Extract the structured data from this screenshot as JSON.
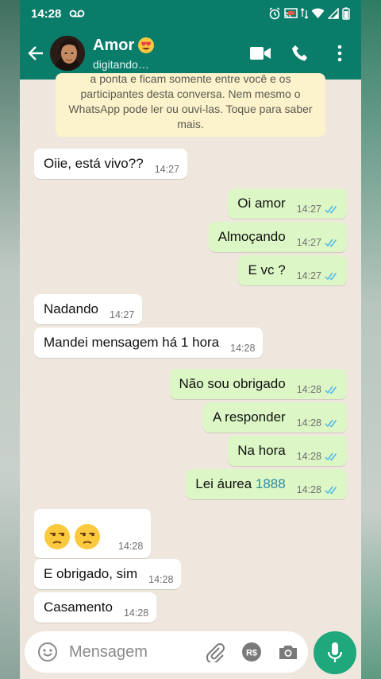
{
  "status": {
    "time": "14:28"
  },
  "header": {
    "title": "Amor",
    "subtitle": "digitando…"
  },
  "notice": {
    "text": "a ponta e ficam somente entre você e os participantes desta conversa. Nem mesmo o WhatsApp pode ler ou ouvi-las. Toque para saber mais."
  },
  "messages": [
    {
      "text": "Oiie, está vivo??",
      "time": "14:27"
    },
    {
      "text": "Oi amor",
      "time": "14:27"
    },
    {
      "text": "Almoçando",
      "time": "14:27"
    },
    {
      "text": "E vc ?",
      "time": "14:27"
    },
    {
      "text": "Nadando",
      "time": "14:27"
    },
    {
      "text": "Mandei mensagem há 1 hora",
      "time": "14:28"
    },
    {
      "text": "Não sou obrigado",
      "time": "14:28"
    },
    {
      "text": "A responder",
      "time": "14:28"
    },
    {
      "text": "Na hora",
      "time": "14:28"
    },
    {
      "text": "Lei áurea",
      "link": "1888",
      "time": "14:28"
    },
    {
      "time": "14:28"
    },
    {
      "text": "E obrigado, sim",
      "time": "14:28"
    },
    {
      "text": "Casamento",
      "time": "14:28"
    }
  ],
  "input": {
    "placeholder": "Mensagem"
  },
  "icons": {
    "back": "arrow-left-icon",
    "video": "video-camera-icon",
    "call": "phone-icon",
    "menu": "more-vertical-icon",
    "emoji": "emoji-icon",
    "attach": "paperclip-icon",
    "payment": "rupee-payment-icon",
    "camera": "camera-icon",
    "mic": "microphone-icon",
    "read": "double-check-icon"
  },
  "colors": {
    "header": "#0a7c6a",
    "outgoing": "#dcf7c5",
    "incoming": "#ffffff",
    "background": "#efe7de",
    "accent": "#1fa87c",
    "read_tick": "#4fb6ec"
  }
}
